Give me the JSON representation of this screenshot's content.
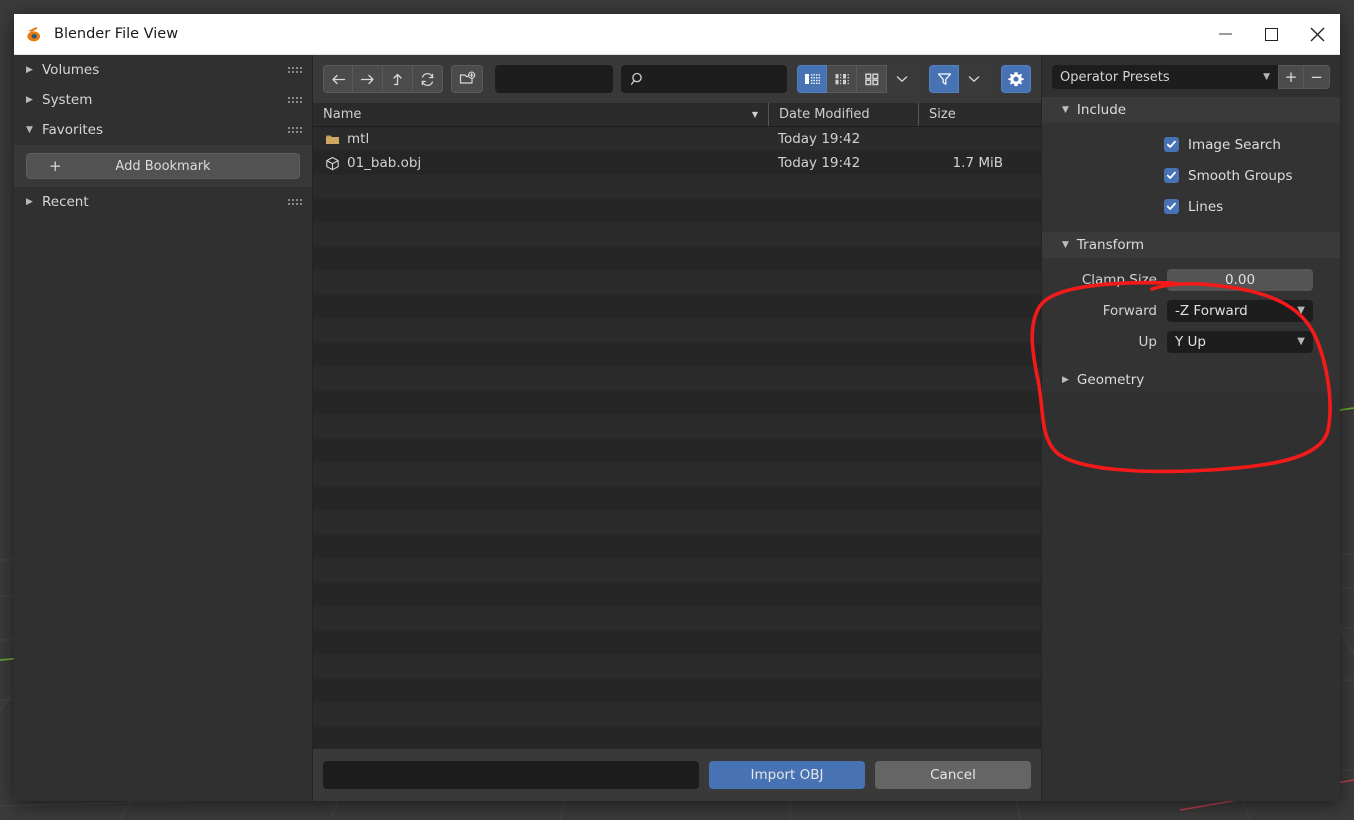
{
  "window": {
    "title": "Blender File View",
    "logo_icon": "blender-logo-icon",
    "minimize_label": "Minimize",
    "maximize_label": "Maximize",
    "close_label": "Close"
  },
  "sidebar": {
    "categories": [
      {
        "label": "Volumes",
        "expanded": false,
        "icon": "triangle-right-icon"
      },
      {
        "label": "System",
        "expanded": false,
        "icon": "triangle-right-icon"
      },
      {
        "label": "Favorites",
        "expanded": true,
        "icon": "triangle-down-icon"
      },
      {
        "label": "Recent",
        "expanded": false,
        "icon": "triangle-right-icon"
      }
    ],
    "add_bookmark_label": "Add Bookmark",
    "add_bookmark_icon": "plus-icon"
  },
  "toolbar": {
    "back_icon": "arrow-left-icon",
    "forward_icon": "arrow-right-icon",
    "up_icon": "arrow-up-parent-icon",
    "refresh_icon": "refresh-icon",
    "new_folder_icon": "new-folder-icon",
    "path_value": "",
    "path_placeholder": "",
    "search_icon": "search-icon",
    "search_value": "",
    "search_placeholder": "",
    "view_modes": [
      {
        "name": "vertical-list-view",
        "icon": "list-view-icon",
        "active": true
      },
      {
        "name": "horizontal-list-view",
        "icon": "detail-view-icon",
        "active": false
      },
      {
        "name": "thumbnail-view",
        "icon": "thumbnail-view-icon",
        "active": false
      }
    ],
    "display_chevron_icon": "chevron-down-icon",
    "filter_icon": "funnel-filter-icon",
    "filter_active": true,
    "filter_chevron_icon": "chevron-down-icon",
    "settings_icon": "gear-icon",
    "settings_active": true
  },
  "filelist": {
    "columns": [
      {
        "key": "name",
        "label": "Name",
        "sorted": true,
        "sort_icon": "triangle-down-icon"
      },
      {
        "key": "date",
        "label": "Date Modified",
        "sorted": false
      },
      {
        "key": "size",
        "label": "Size",
        "sorted": false
      }
    ],
    "rows": [
      {
        "name": "mtl",
        "date": "Today 19:42",
        "size": "",
        "icon": "folder-icon",
        "type": "folder"
      },
      {
        "name": "01_bab.obj",
        "date": "Today 19:42",
        "size": "1.7 MiB",
        "icon": "mesh-object-icon",
        "type": "file"
      }
    ],
    "empty_row_count": 24
  },
  "bottombar": {
    "filename_value": "",
    "filename_placeholder": "",
    "import_label": "Import OBJ",
    "cancel_label": "Cancel"
  },
  "properties": {
    "preset": {
      "label": "Operator Presets",
      "chevron_icon": "chevron-down-icon",
      "add_label": "+",
      "remove_label": "−"
    },
    "panels": [
      {
        "name": "include",
        "title": "Include",
        "expanded": true,
        "toggle_icon": "triangle-down-icon",
        "checkboxes": [
          {
            "label": "Image Search",
            "checked": true
          },
          {
            "label": "Smooth Groups",
            "checked": true
          },
          {
            "label": "Lines",
            "checked": true
          }
        ]
      },
      {
        "name": "transform",
        "title": "Transform",
        "expanded": true,
        "toggle_icon": "triangle-down-icon",
        "fields": [
          {
            "label": "Clamp Size",
            "value": "0.00",
            "kind": "number"
          },
          {
            "label": "Forward",
            "value": "-Z Forward",
            "kind": "select",
            "chevron_icon": "chevron-down-icon"
          },
          {
            "label": "Up",
            "value": "Y Up",
            "kind": "select",
            "chevron_icon": "chevron-down-icon"
          }
        ]
      },
      {
        "name": "geometry",
        "title": "Geometry",
        "expanded": false,
        "toggle_icon": "triangle-right-icon",
        "fields": []
      }
    ]
  },
  "annotation": {
    "shape": "hand-drawn-ellipse",
    "color": "#f41a1a",
    "target": "transform-panel"
  },
  "colors": {
    "accent_blue": "#4772b3",
    "window_chrome": "#303030",
    "panel": "#333333",
    "list_bg": "#262626",
    "folder_yellow": "#cfa864",
    "viewport_bg": "#3b3b3b",
    "axis_green": "#6aa832",
    "axis_red": "#bf3f4f"
  }
}
